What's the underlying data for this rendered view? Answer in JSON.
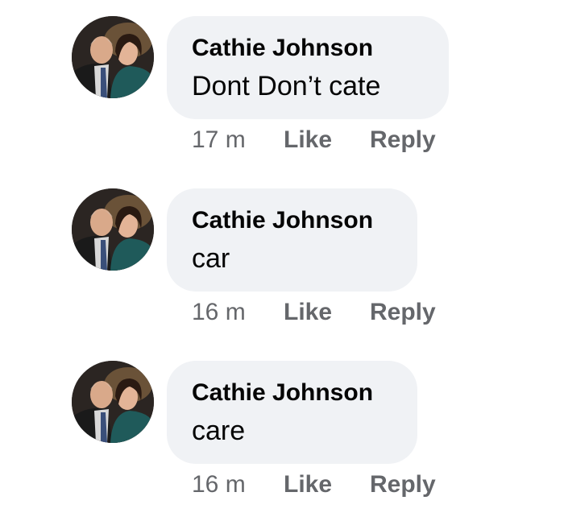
{
  "comments": [
    {
      "author": "Cathie Johnson",
      "text": "Dont Don’t cate",
      "time": "17 m",
      "like_label": "Like",
      "reply_label": "Reply"
    },
    {
      "author": "Cathie Johnson",
      "text": "car",
      "time": "16 m",
      "like_label": "Like",
      "reply_label": "Reply"
    },
    {
      "author": "Cathie Johnson",
      "text": "care",
      "time": "16 m",
      "like_label": "Like",
      "reply_label": "Reply"
    }
  ],
  "colors": {
    "bubble_bg": "#f0f2f5",
    "meta_text": "#65676b",
    "primary_text": "#050505"
  }
}
